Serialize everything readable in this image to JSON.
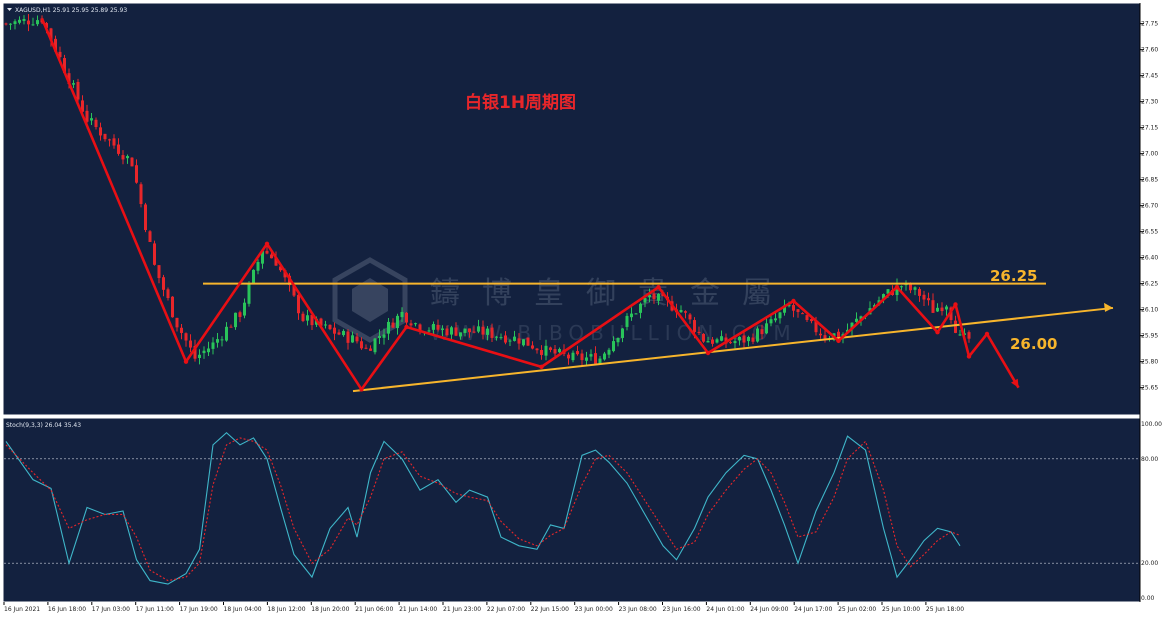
{
  "window": {
    "symbol_info": "XAGUSD,H1  25.91 25.95 25.89 25.93"
  },
  "colors": {
    "background": "#13213f",
    "bull": "#29c45a",
    "bear": "#e8262a",
    "trend": "#e80f14",
    "level": "#f7b52c",
    "stoch_main": "#3fb6c9",
    "stoch_signal": "#e8262a",
    "grid": "#c8cedb"
  },
  "chart_data": [
    {
      "type": "candlestick",
      "title": "白银1H周期图",
      "watermark": {
        "brand": "鑄博皇御貴金屬",
        "url": "WWW.BIBOBULLION.COM"
      },
      "ylim": [
        25.55,
        27.8
      ],
      "y_ticks": [
        27.75,
        27.6,
        27.45,
        27.3,
        27.15,
        27.0,
        26.85,
        26.7,
        26.55,
        26.4,
        26.25,
        26.1,
        25.95,
        25.8,
        25.65
      ],
      "x_ticks": [
        "16 Jun 2021",
        "16 Jun 18:00",
        "17 Jun 03:00",
        "17 Jun 11:00",
        "17 Jun 19:00",
        "18 Jun 04:00",
        "18 Jun 12:00",
        "18 Jun 20:00",
        "21 Jun 06:00",
        "21 Jun 14:00",
        "21 Jun 23:00",
        "22 Jun 07:00",
        "22 Jun 15:00",
        "23 Jun 00:00",
        "23 Jun 08:00",
        "23 Jun 16:00",
        "24 Jun 01:00",
        "24 Jun 09:00",
        "24 Jun 17:00",
        "25 Jun 02:00",
        "25 Jun 10:00",
        "25 Jun 18:00"
      ],
      "bar_count": 215,
      "price_path": [
        [
          0,
          27.75
        ],
        [
          8,
          27.78
        ],
        [
          12,
          27.55
        ],
        [
          18,
          27.2
        ],
        [
          22,
          27.1
        ],
        [
          28,
          26.95
        ],
        [
          33,
          26.35
        ],
        [
          38,
          26.02
        ],
        [
          42,
          25.82
        ],
        [
          46,
          25.9
        ],
        [
          52,
          26.08
        ],
        [
          57,
          26.45
        ],
        [
          60,
          26.38
        ],
        [
          66,
          26.05
        ],
        [
          72,
          25.98
        ],
        [
          78,
          25.92
        ],
        [
          80,
          25.87
        ],
        [
          84,
          25.98
        ],
        [
          88,
          26.08
        ],
        [
          92,
          26.0
        ],
        [
          98,
          25.98
        ],
        [
          106,
          25.97
        ],
        [
          114,
          25.93
        ],
        [
          120,
          25.86
        ],
        [
          126,
          25.82
        ],
        [
          132,
          25.82
        ],
        [
          138,
          26.04
        ],
        [
          143,
          26.18
        ],
        [
          150,
          26.1
        ],
        [
          155,
          25.93
        ],
        [
          160,
          25.91
        ],
        [
          165,
          25.93
        ],
        [
          170,
          26.02
        ],
        [
          174,
          26.12
        ],
        [
          178,
          26.02
        ],
        [
          182,
          25.95
        ],
        [
          186,
          25.96
        ],
        [
          190,
          26.06
        ],
        [
          195,
          26.18
        ],
        [
          199,
          26.24
        ],
        [
          203,
          26.19
        ],
        [
          206,
          26.1
        ],
        [
          209,
          26.14
        ],
        [
          212,
          25.93
        ],
        [
          214,
          25.93
        ]
      ],
      "levels": [
        {
          "label": "26.25",
          "value": 26.25
        },
        {
          "label": "26.00",
          "value": 26.0
        }
      ],
      "support_trendline": {
        "from": {
          "x": "18 Jun 20:00",
          "y": 25.63
        },
        "to": {
          "y": 26.11
        }
      },
      "zigzag": [
        [
          8,
          27.78
        ],
        [
          40,
          25.8
        ],
        [
          58,
          26.48
        ],
        [
          79,
          25.64
        ],
        [
          89,
          26.0
        ],
        [
          119,
          25.77
        ],
        [
          145,
          26.23
        ],
        [
          156,
          25.85
        ],
        [
          175,
          26.15
        ],
        [
          185,
          25.92
        ],
        [
          198,
          26.23
        ],
        [
          207,
          25.97
        ],
        [
          211,
          26.13
        ],
        [
          214,
          25.83
        ],
        [
          218,
          25.96
        ],
        [
          225,
          25.65
        ]
      ]
    },
    {
      "type": "line",
      "title": "Stoch(9,3,3) 26.04 35.43",
      "ylim": [
        0,
        100
      ],
      "y_ticks": [
        100.0,
        80.0,
        20.0,
        0.0
      ],
      "levels": [
        80,
        20
      ],
      "series": [
        {
          "name": "main",
          "points": [
            [
              0,
              90
            ],
            [
              6,
              68
            ],
            [
              10,
              63
            ],
            [
              14,
              20
            ],
            [
              18,
              52
            ],
            [
              22,
              48
            ],
            [
              26,
              50
            ],
            [
              29,
              22
            ],
            [
              32,
              10
            ],
            [
              36,
              8
            ],
            [
              40,
              14
            ],
            [
              43,
              28
            ],
            [
              46,
              88
            ],
            [
              49,
              95
            ],
            [
              52,
              88
            ],
            [
              55,
              92
            ],
            [
              58,
              80
            ],
            [
              61,
              52
            ],
            [
              64,
              25
            ],
            [
              68,
              12
            ],
            [
              72,
              40
            ],
            [
              76,
              52
            ],
            [
              78,
              35
            ],
            [
              81,
              72
            ],
            [
              84,
              90
            ],
            [
              88,
              80
            ],
            [
              92,
              62
            ],
            [
              96,
              68
            ],
            [
              100,
              55
            ],
            [
              103,
              62
            ],
            [
              107,
              58
            ],
            [
              110,
              35
            ],
            [
              114,
              30
            ],
            [
              118,
              28
            ],
            [
              121,
              42
            ],
            [
              124,
              40
            ],
            [
              128,
              82
            ],
            [
              131,
              85
            ],
            [
              134,
              78
            ],
            [
              138,
              66
            ],
            [
              142,
              48
            ],
            [
              146,
              30
            ],
            [
              149,
              22
            ],
            [
              153,
              40
            ],
            [
              156,
              58
            ],
            [
              160,
              72
            ],
            [
              164,
              82
            ],
            [
              167,
              80
            ],
            [
              170,
              62
            ],
            [
              173,
              42
            ],
            [
              176,
              20
            ],
            [
              180,
              50
            ],
            [
              184,
              72
            ],
            [
              187,
              93
            ],
            [
              191,
              85
            ],
            [
              195,
              40
            ],
            [
              198,
              12
            ],
            [
              201,
              22
            ],
            [
              204,
              33
            ],
            [
              207,
              40
            ],
            [
              210,
              38
            ],
            [
              212,
              30
            ]
          ]
        },
        {
          "name": "signal",
          "points": [
            [
              0,
              88
            ],
            [
              6,
              72
            ],
            [
              10,
              62
            ],
            [
              14,
              40
            ],
            [
              18,
              45
            ],
            [
              22,
              48
            ],
            [
              26,
              48
            ],
            [
              29,
              35
            ],
            [
              32,
              16
            ],
            [
              36,
              10
            ],
            [
              40,
              12
            ],
            [
              43,
              20
            ],
            [
              46,
              65
            ],
            [
              49,
              88
            ],
            [
              52,
              92
            ],
            [
              55,
              90
            ],
            [
              58,
              85
            ],
            [
              61,
              65
            ],
            [
              64,
              40
            ],
            [
              68,
              20
            ],
            [
              72,
              28
            ],
            [
              76,
              46
            ],
            [
              78,
              42
            ],
            [
              81,
              58
            ],
            [
              84,
              80
            ],
            [
              88,
              84
            ],
            [
              92,
              70
            ],
            [
              96,
              66
            ],
            [
              100,
              60
            ],
            [
              103,
              58
            ],
            [
              107,
              56
            ],
            [
              110,
              44
            ],
            [
              114,
              34
            ],
            [
              118,
              30
            ],
            [
              121,
              36
            ],
            [
              124,
              40
            ],
            [
              128,
              65
            ],
            [
              131,
              80
            ],
            [
              134,
              82
            ],
            [
              138,
              72
            ],
            [
              142,
              56
            ],
            [
              146,
              40
            ],
            [
              149,
              28
            ],
            [
              153,
              32
            ],
            [
              156,
              48
            ],
            [
              160,
              62
            ],
            [
              164,
              74
            ],
            [
              167,
              80
            ],
            [
              170,
              72
            ],
            [
              173,
              55
            ],
            [
              176,
              35
            ],
            [
              180,
              38
            ],
            [
              184,
              58
            ],
            [
              187,
              80
            ],
            [
              191,
              90
            ],
            [
              195,
              62
            ],
            [
              198,
              30
            ],
            [
              201,
              18
            ],
            [
              204,
              25
            ],
            [
              207,
              33
            ],
            [
              210,
              38
            ],
            [
              212,
              36
            ]
          ]
        }
      ]
    }
  ]
}
